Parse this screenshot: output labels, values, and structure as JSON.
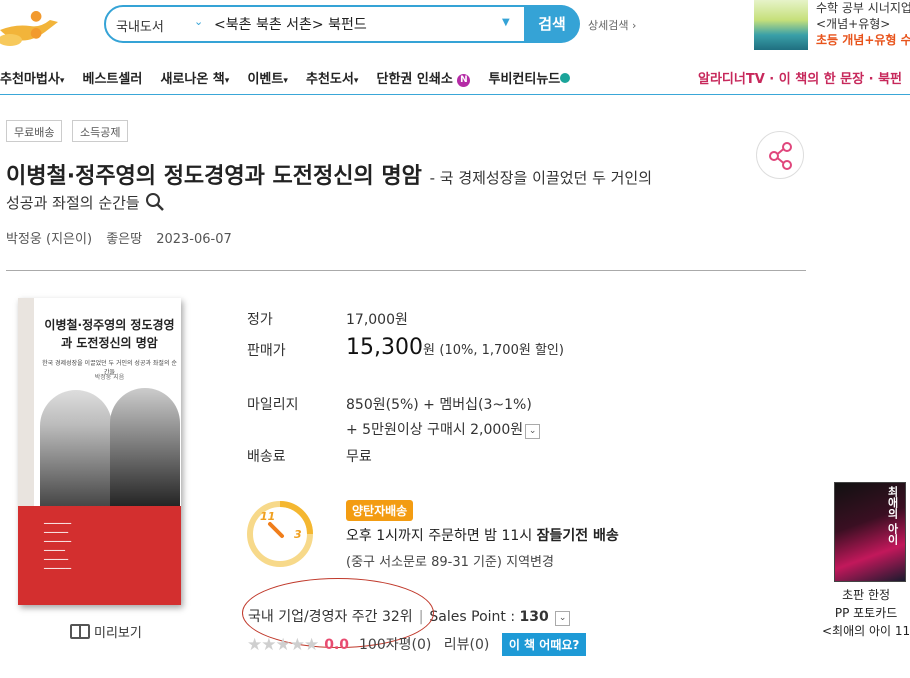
{
  "header": {
    "search_category": "국내도서",
    "search_query": "<북촌 북촌 서촌> 북펀드",
    "search_button": "검색",
    "advanced_search": "상세검색",
    "ad_line1": "수학 공부 시너지업!",
    "ad_line2": "<개념+유형>",
    "ad_line3": "초등 개념+유형 수학"
  },
  "nav": {
    "items": [
      "추천마법사",
      "베스트셀러",
      "새로나온 책",
      "이벤트",
      "추천도서",
      "단한권 인쇄소",
      "투비컨티뉴드"
    ],
    "right": "알라디너TV · 이 책의 한 문장 · 북펀"
  },
  "tags": [
    "무료배송",
    "소득공제"
  ],
  "book": {
    "title": "이병철·정주영의 정도경영과 도전정신의 명암",
    "subtitle": "- 국 경제성장을 이끌었던 두 거인의",
    "subtitle2": "성공과 좌절의 순간들",
    "author": "박정웅 (지은이)",
    "publisher": "좋은땅",
    "date": "2023-06-07",
    "cover_title": "이병철·정주영의 정도경영과 도전정신의 명암",
    "cover_sub": "한국 경제성장을 이끌었던 두 거인의 성공과 좌절의 순간들",
    "cover_author": "박정웅 지음",
    "preview": "미리보기"
  },
  "price": {
    "list_label": "정가",
    "list_value": "17,000원",
    "sale_label": "판매가",
    "sale_value": "15,300",
    "sale_unit": "원",
    "sale_discount": "(10%, 1,700원 할인)",
    "mileage_label": "마일리지",
    "mileage_value": "850원(5%) + 멤버십(3~1%)",
    "mileage_extra": "+ 5만원이상 구매시 2,000원",
    "shipping_label": "배송료",
    "shipping_value": "무료"
  },
  "delivery": {
    "badge": "양탄자배송",
    "line1_a": "오후 1시까지 주문하면 밤 11시 ",
    "line1_b": "잠들기전 배송",
    "line2": "(중구 서소문로 89-31 기준) 지역변경",
    "clock_11": "11",
    "clock_3": "3"
  },
  "rank": {
    "text": "국내 기업/경영자 주간 32위",
    "sales_point_label": "Sales Point : ",
    "sales_point_value": "130"
  },
  "rating": {
    "score": "0.0",
    "reviews_100": "100자평(0)",
    "reviews": "리뷰(0)",
    "ask": "이 책 어때요?"
  },
  "side_ad": {
    "cover_title": "최애의 아이",
    "line1": "초판 한정",
    "line2": "PP 포토카드",
    "line3": "<최애의 아이 11"
  },
  "colors": {
    "accent": "#35a3d6",
    "nav_pink": "#c7285b",
    "star_score": "#e84c71",
    "delivery_badge": "#f39c12",
    "cover_red": "#d32f2f"
  }
}
